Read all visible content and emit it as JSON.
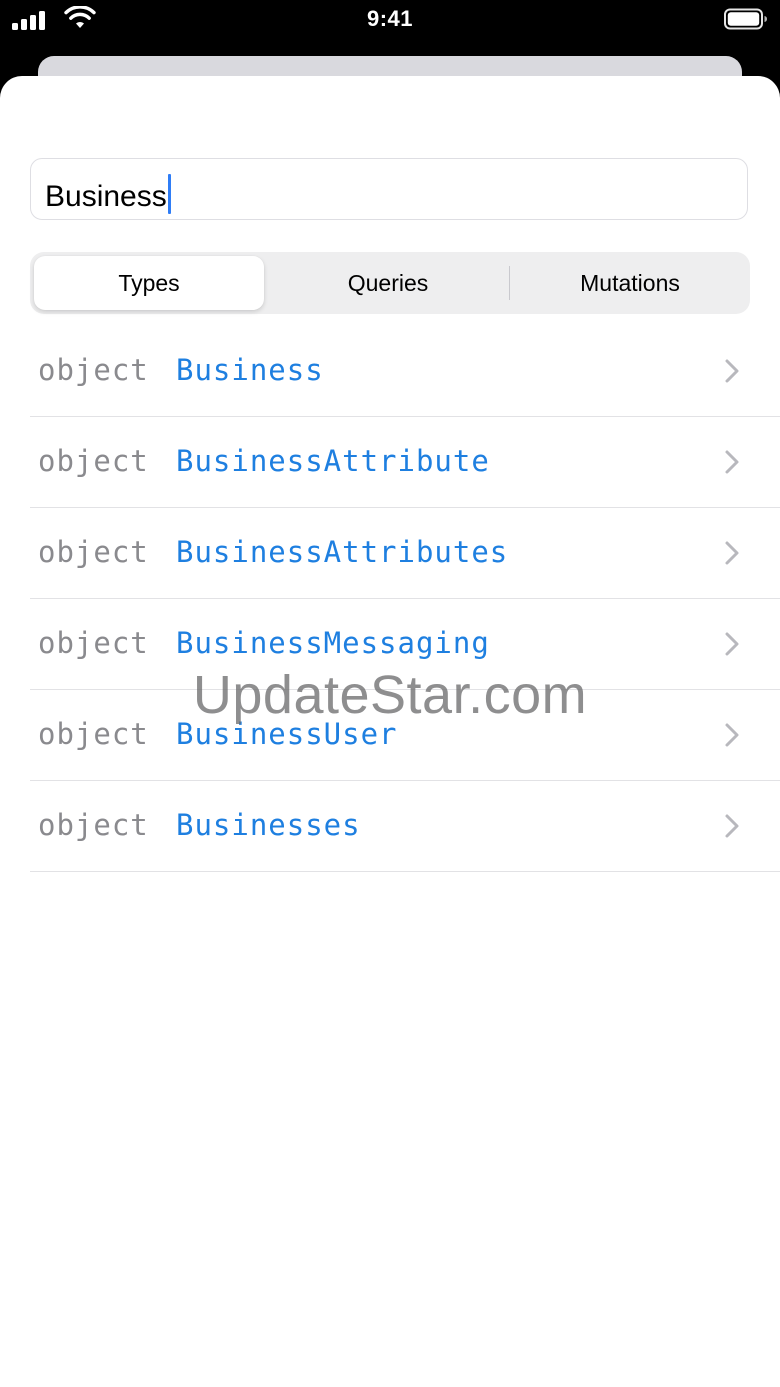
{
  "status_bar": {
    "time": "9:41"
  },
  "search": {
    "value": "Business"
  },
  "segments": {
    "items": [
      {
        "label": "Types",
        "selected": true
      },
      {
        "label": "Queries",
        "selected": false
      },
      {
        "label": "Mutations",
        "selected": false
      }
    ]
  },
  "results": [
    {
      "kind": "object",
      "name": "Business"
    },
    {
      "kind": "object",
      "name": "BusinessAttribute"
    },
    {
      "kind": "object",
      "name": "BusinessAttributes"
    },
    {
      "kind": "object",
      "name": "BusinessMessaging"
    },
    {
      "kind": "object",
      "name": "BusinessUser"
    },
    {
      "kind": "object",
      "name": "Businesses"
    }
  ],
  "watermark": "UpdateStar.com",
  "icons": {
    "signal": "cellular-signal-icon",
    "wifi": "wifi-icon",
    "battery": "battery-icon",
    "row_disclosure": "chevron-right-icon"
  },
  "colors": {
    "type_name": "#1e7fe0",
    "type_kind": "#8a8a8e",
    "caret": "#2f7df6",
    "segment_track": "#eeeeef"
  }
}
